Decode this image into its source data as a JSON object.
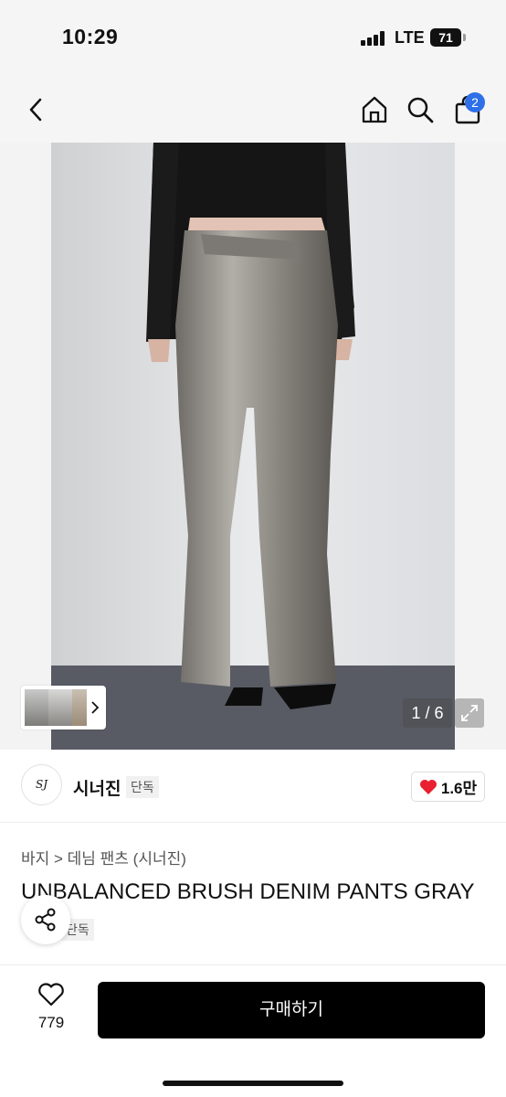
{
  "status_bar": {
    "time": "10:29",
    "network": "LTE",
    "battery": "71"
  },
  "nav": {
    "back_icon": "chevron-left-icon",
    "home_icon": "home-icon",
    "search_icon": "search-icon",
    "cart_icon": "shopping-bag-icon",
    "cart_count": "2"
  },
  "gallery": {
    "page_indicator": "1 / 6",
    "current_page": 1,
    "total_pages": 6,
    "thumbnail_icon": "chevron-right-icon",
    "expand_icon": "expand-icon"
  },
  "brand": {
    "logo_text": "SJ",
    "name": "시너진",
    "tag": "단독",
    "like_count": "1.6만"
  },
  "product": {
    "breadcrumb": [
      "바지",
      "데님 팬츠 (시너진)"
    ],
    "breadcrumb_text": "바지 > 데님 팬츠 (시너진)",
    "title": "UNBALANCED BRUSH DENIM PANTS GRAY",
    "tag": "단독"
  },
  "actions": {
    "share_icon": "share-icon",
    "wish_icon": "heart-outline-icon",
    "wish_count": "779",
    "buy_label": "구매하기"
  },
  "colors": {
    "accent_badge": "#2f6fe8",
    "heart": "#e8202f",
    "buy_button": "#000000"
  }
}
